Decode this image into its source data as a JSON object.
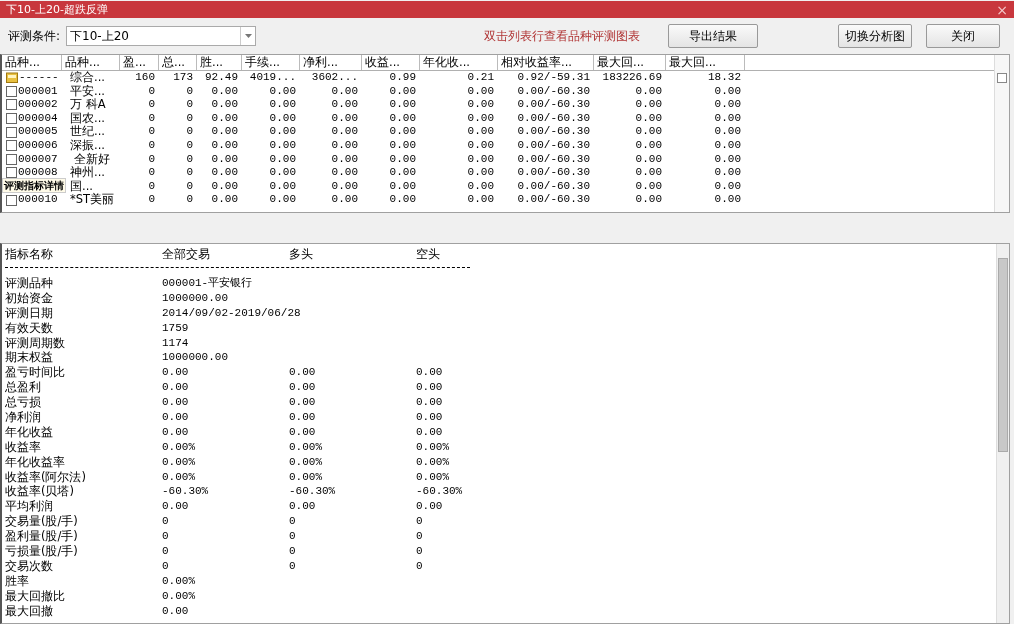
{
  "window": {
    "title": "下10-上20-超跌反弹",
    "close": "×"
  },
  "toolbar": {
    "condition_label": "评测条件:",
    "condition_value": "下10-上20",
    "hint": "双击列表行查看品种评测图表",
    "buttons": [
      {
        "label": "导出结果",
        "kind": "left"
      },
      {
        "label": "切换分析图",
        "kind": "right"
      },
      {
        "label": "关闭",
        "kind": "right"
      }
    ]
  },
  "table": {
    "columns": [
      "品种...",
      "品种...",
      "盈...",
      "总...",
      "胜...",
      "手续...",
      "净利...",
      "收益...",
      "年化收...",
      "相对收益率...",
      "最大回...",
      "最大回..."
    ],
    "rows": [
      {
        "kind": "group",
        "cells": [
          "------",
          "综合...",
          "160",
          "173",
          "92.49",
          "4019...",
          "3602...",
          "0.99",
          "0.21",
          "0.92/-59.31",
          "183226.69",
          "18.32"
        ]
      },
      {
        "kind": "item",
        "checked": false,
        "cells": [
          "000001",
          "平安...",
          "0",
          "0",
          "0.00",
          "0.00",
          "0.00",
          "0.00",
          "0.00",
          "0.00/-60.30",
          "0.00",
          "0.00"
        ]
      },
      {
        "kind": "item",
        "checked": false,
        "cells": [
          "000002",
          "万 科A",
          "0",
          "0",
          "0.00",
          "0.00",
          "0.00",
          "0.00",
          "0.00",
          "0.00/-60.30",
          "0.00",
          "0.00"
        ]
      },
      {
        "kind": "item",
        "checked": false,
        "cells": [
          "000004",
          "国农...",
          "0",
          "0",
          "0.00",
          "0.00",
          "0.00",
          "0.00",
          "0.00",
          "0.00/-60.30",
          "0.00",
          "0.00"
        ]
      },
      {
        "kind": "item",
        "checked": false,
        "cells": [
          "000005",
          "世纪...",
          "0",
          "0",
          "0.00",
          "0.00",
          "0.00",
          "0.00",
          "0.00",
          "0.00/-60.30",
          "0.00",
          "0.00"
        ]
      },
      {
        "kind": "item",
        "checked": false,
        "cells": [
          "000006",
          "深振...",
          "0",
          "0",
          "0.00",
          "0.00",
          "0.00",
          "0.00",
          "0.00",
          "0.00/-60.30",
          "0.00",
          "0.00"
        ]
      },
      {
        "kind": "item",
        "checked": false,
        "cells": [
          "000007",
          " 全新好",
          "0",
          "0",
          "0.00",
          "0.00",
          "0.00",
          "0.00",
          "0.00",
          "0.00/-60.30",
          "0.00",
          "0.00"
        ]
      },
      {
        "kind": "item",
        "checked": false,
        "cells": [
          "000008",
          "神州...",
          "0",
          "0",
          "0.00",
          "0.00",
          "0.00",
          "0.00",
          "0.00",
          "0.00/-60.30",
          "0.00",
          "0.00"
        ]
      },
      {
        "kind": "covered",
        "cells": [
          "",
          "国...",
          "0",
          "0",
          "0.00",
          "0.00",
          "0.00",
          "0.00",
          "0.00",
          "0.00/-60.30",
          "0.00",
          "0.00"
        ]
      },
      {
        "kind": "item",
        "checked": false,
        "cells": [
          "000010",
          "*ST美丽",
          "0",
          "0",
          "0.00",
          "0.00",
          "0.00",
          "0.00",
          "0.00",
          "0.00/-60.30",
          "0.00",
          "0.00"
        ]
      }
    ],
    "tooltip": "评测指标详情"
  },
  "details": {
    "columns": [
      "指标名称",
      "全部交易",
      "多头",
      "空头"
    ],
    "rows": [
      [
        "评测品种",
        "000001-平安银行"
      ],
      [
        "初始资金",
        "1000000.00"
      ],
      [
        "评测日期",
        "2014/09/02-2019/06/28"
      ],
      [
        "有效天数",
        "1759"
      ],
      [
        "评测周期数",
        "1174"
      ],
      [
        "期末权益",
        "1000000.00"
      ],
      [
        "盈亏时间比",
        "0.00",
        "0.00",
        "0.00"
      ],
      [
        "总盈利",
        "0.00",
        "0.00",
        "0.00"
      ],
      [
        "总亏损",
        "0.00",
        "0.00",
        "0.00"
      ],
      [
        "净利润",
        "0.00",
        "0.00",
        "0.00"
      ],
      [
        "年化收益",
        "0.00",
        "0.00",
        "0.00"
      ],
      [
        "收益率",
        "0.00%",
        "0.00%",
        "0.00%"
      ],
      [
        "年化收益率",
        "0.00%",
        "0.00%",
        "0.00%"
      ],
      [
        "收益率(阿尔法)",
        "0.00%",
        "0.00%",
        "0.00%"
      ],
      [
        "收益率(贝塔)",
        "-60.30%",
        "-60.30%",
        "-60.30%"
      ],
      [
        "平均利润",
        "0.00",
        "0.00",
        "0.00"
      ],
      [
        "交易量(股/手)",
        "0",
        "0",
        "0"
      ],
      [
        "盈利量(股/手)",
        "0",
        "0",
        "0"
      ],
      [
        "亏损量(股/手)",
        "0",
        "0",
        "0"
      ],
      [
        "交易次数",
        "0",
        "0",
        "0"
      ],
      [
        "胜率",
        "0.00%"
      ],
      [
        "最大回撤比",
        "0.00%"
      ],
      [
        "最大回撤",
        "0.00"
      ]
    ]
  }
}
